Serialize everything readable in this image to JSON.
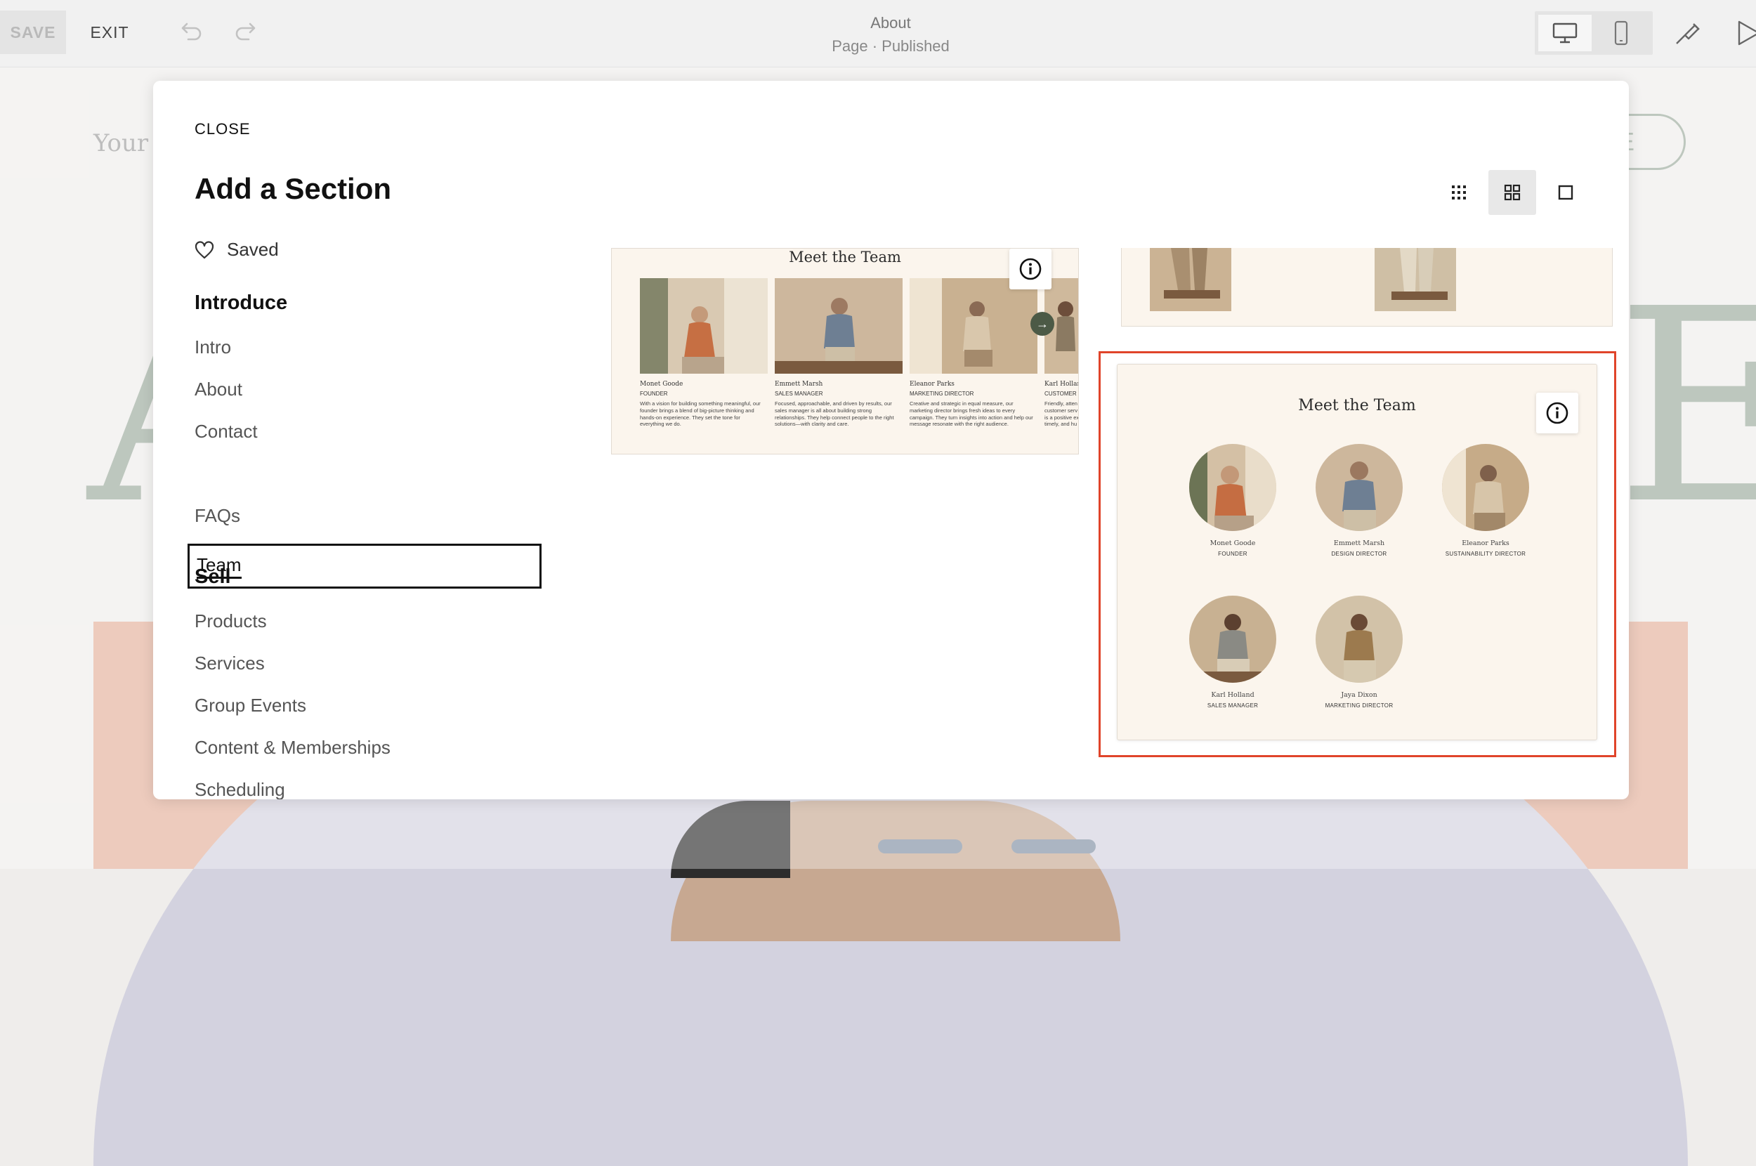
{
  "topbar": {
    "save_label": "SAVE",
    "exit_label": "EXIT",
    "page_title": "About",
    "page_status": "Page · Published"
  },
  "background": {
    "logo_text": "Your S",
    "cta_text": "ME",
    "big_letter_left": "A",
    "big_letter_right": "E"
  },
  "modal": {
    "close_label": "CLOSE",
    "title": "Add a Section",
    "saved_label": "Saved",
    "categories": [
      {
        "label": "Introduce",
        "items": [
          "Intro",
          "About",
          "Contact",
          "Team",
          "FAQs"
        ]
      },
      {
        "label": "Sell",
        "items": [
          "Products",
          "Services",
          "Group Events",
          "Content & Memberships",
          "Scheduling"
        ]
      }
    ],
    "selected_item": "Team",
    "view_modes": [
      "small-grid-icon",
      "medium-grid-icon",
      "single-view-icon"
    ],
    "active_view": "medium-grid-icon"
  },
  "cards": {
    "carousel": {
      "title": "Meet the Team",
      "members": [
        {
          "name": "Monet Goode",
          "role": "FOUNDER",
          "desc": "With a vision for building something meaningful, our founder brings a blend of big-picture thinking and hands-on experience. They set the tone for everything we do."
        },
        {
          "name": "Emmett Marsh",
          "role": "SALES MANAGER",
          "desc": "Focused, approachable, and driven by results, our sales manager is all about building strong relationships. They help connect people to the right solutions—with clarity and care."
        },
        {
          "name": "Eleanor Parks",
          "role": "MARKETING DIRECTOR",
          "desc": "Creative and strategic in equal measure, our marketing director brings fresh ideas to every campaign. They turn insights into action and help our message resonate with the right audience."
        },
        {
          "name": "Karl Hollan",
          "role": "CUSTOMER S",
          "desc": "Friendly, atten customer serv is a positive ex timely, and hu"
        }
      ]
    },
    "grid": {
      "title": "Meet the Team",
      "members": [
        {
          "name": "Monet Goode",
          "role": "FOUNDER"
        },
        {
          "name": "Emmett Marsh",
          "role": "DESIGN DIRECTOR"
        },
        {
          "name": "Eleanor Parks",
          "role": "SUSTAINABILITY DIRECTOR"
        },
        {
          "name": "Karl Holland",
          "role": "SALES MANAGER"
        },
        {
          "name": "Jaya Dixon",
          "role": "MARKETING DIRECTOR"
        }
      ]
    }
  },
  "colors": {
    "accent_highlight": "#e0442a",
    "card_bg": "#fbf5ed",
    "sage": "#9aa99c",
    "arrow_green": "#4c5a46"
  }
}
